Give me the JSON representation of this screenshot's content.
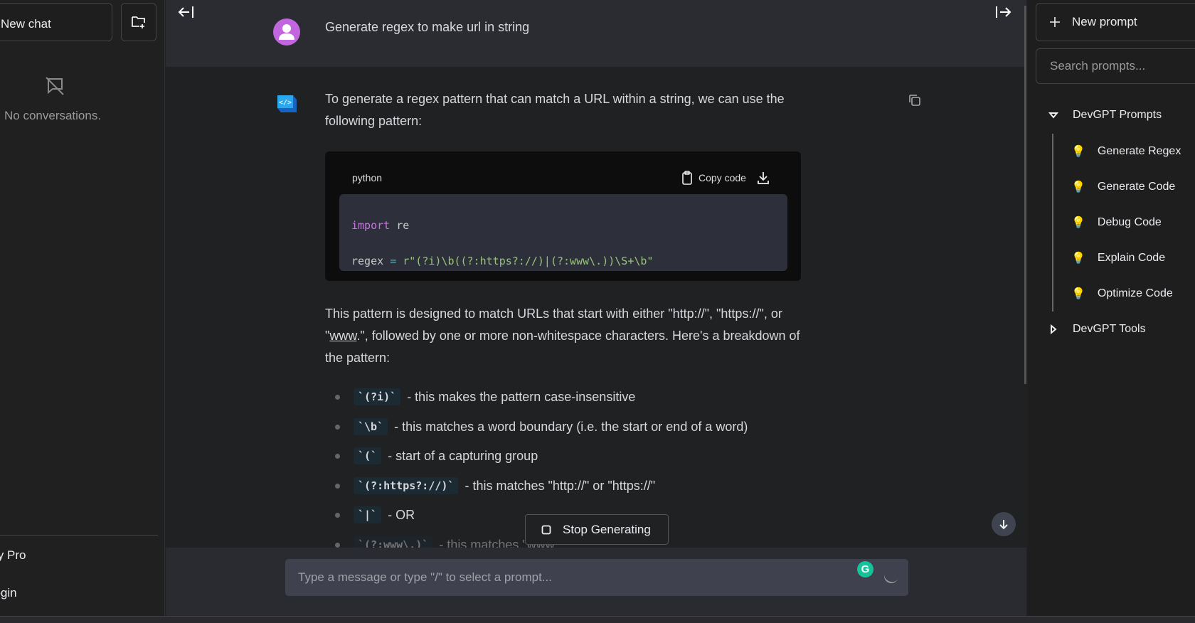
{
  "left": {
    "new_chat": "New chat",
    "empty": "No conversations.",
    "links": [
      "Buy Pro",
      "Login"
    ]
  },
  "user_message": "Generate regex to make url in string",
  "assistant": {
    "intro": "To generate a regex pattern that can match a URL within a string, we can use the following pattern:",
    "code": {
      "language": "python",
      "copy_label": "Copy code",
      "lines": [
        {
          "kw": "import",
          "rest": " re"
        },
        {
          "var": "regex",
          "op": "=",
          "str": "r\"(?i)\\b((?:https?://)|(?:www\\.))\\S+\\b\""
        }
      ]
    },
    "para_a": "This pattern is designed to match URLs that start with either \"http://\", \"https://\", or \"",
    "para_link": "www",
    "para_b": ".\", followed by one or more non-whitespace characters. Here's a breakdown of the pattern:",
    "bullets": [
      {
        "code": "`(?i)`",
        "text": "- this makes the pattern case-insensitive"
      },
      {
        "code": "`\\b`",
        "text": "- this matches a word boundary (i.e. the start or end of a word)"
      },
      {
        "code": "`(`",
        "text": "- start of a capturing group"
      },
      {
        "code": "`(?:https?://)`",
        "text": "- this matches \"http://\" or \"https://\""
      },
      {
        "code": "`|`",
        "text": "- OR"
      },
      {
        "code": "`(?:www\\.)`",
        "text": "- this matches \"www."
      }
    ]
  },
  "stop_label": "Stop Generating",
  "input_placeholder": "Type a message or type \"/\" to select a prompt...",
  "right": {
    "new_prompt": "New prompt",
    "search_placeholder": "Search prompts...",
    "folders": [
      {
        "name": "DevGPT Prompts",
        "expanded": true,
        "items": [
          "Generate Regex",
          "Generate Code",
          "Debug Code",
          "Explain Code",
          "Optimize Code"
        ]
      },
      {
        "name": "DevGPT Tools",
        "expanded": false
      }
    ]
  },
  "colors": {
    "avatar": "#c266e0",
    "grammarly": "#15c39a",
    "keyword": "#c678dd",
    "string": "#98c379"
  }
}
